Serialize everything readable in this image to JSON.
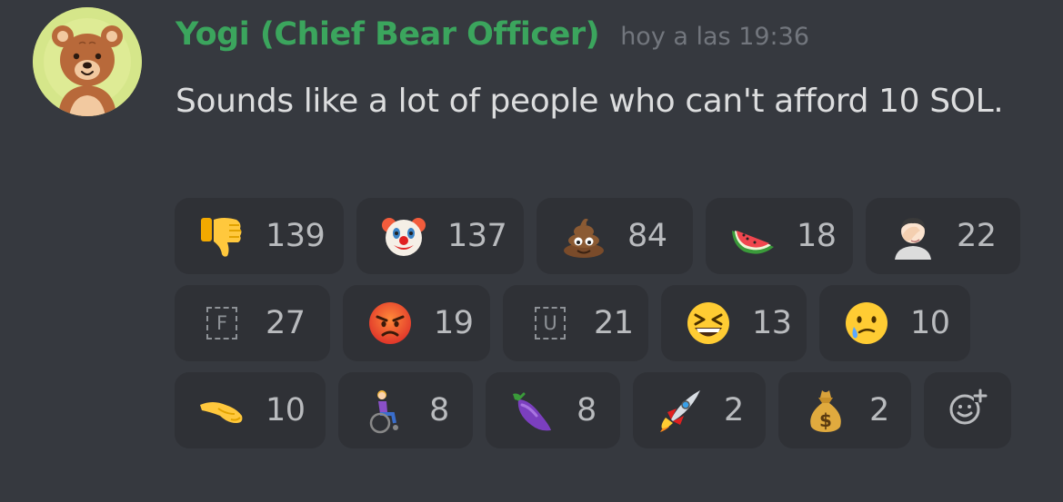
{
  "message": {
    "author": "Yogi (Chief Bear Officer)",
    "timestamp": "hoy a las 19:36",
    "content": "Sounds like a lot of people who can't afford 10 SOL."
  },
  "colors": {
    "background": "#36393f",
    "reaction_background": "#2f3136",
    "username": "#3ba55d",
    "timestamp": "#72767d",
    "content": "#dcddde",
    "count": "#b9bbbe"
  },
  "reactions": [
    {
      "icon": "thumbs-down-icon",
      "count": "139"
    },
    {
      "icon": "clown-face-icon",
      "count": "137"
    },
    {
      "icon": "pile-of-poo-icon",
      "count": "84"
    },
    {
      "icon": "watermelon-icon",
      "count": "18"
    },
    {
      "icon": "facepalm-icon",
      "count": "22"
    },
    {
      "icon": "custom-emoji-f",
      "label": "F",
      "count": "27"
    },
    {
      "icon": "angry-face-icon",
      "count": "19"
    },
    {
      "icon": "custom-emoji-u",
      "label": "U",
      "count": "21"
    },
    {
      "icon": "grinning-squinting-face-icon",
      "count": "13"
    },
    {
      "icon": "smiling-face-with-tear-icon",
      "count": "10"
    },
    {
      "icon": "pinching-hand-icon",
      "count": "10"
    },
    {
      "icon": "person-in-wheelchair-icon",
      "count": "8"
    },
    {
      "icon": "eggplant-icon",
      "count": "8"
    },
    {
      "icon": "rocket-icon",
      "count": "2"
    },
    {
      "icon": "money-bag-icon",
      "count": "2"
    }
  ],
  "add_reaction_icon": "add-reaction-icon"
}
